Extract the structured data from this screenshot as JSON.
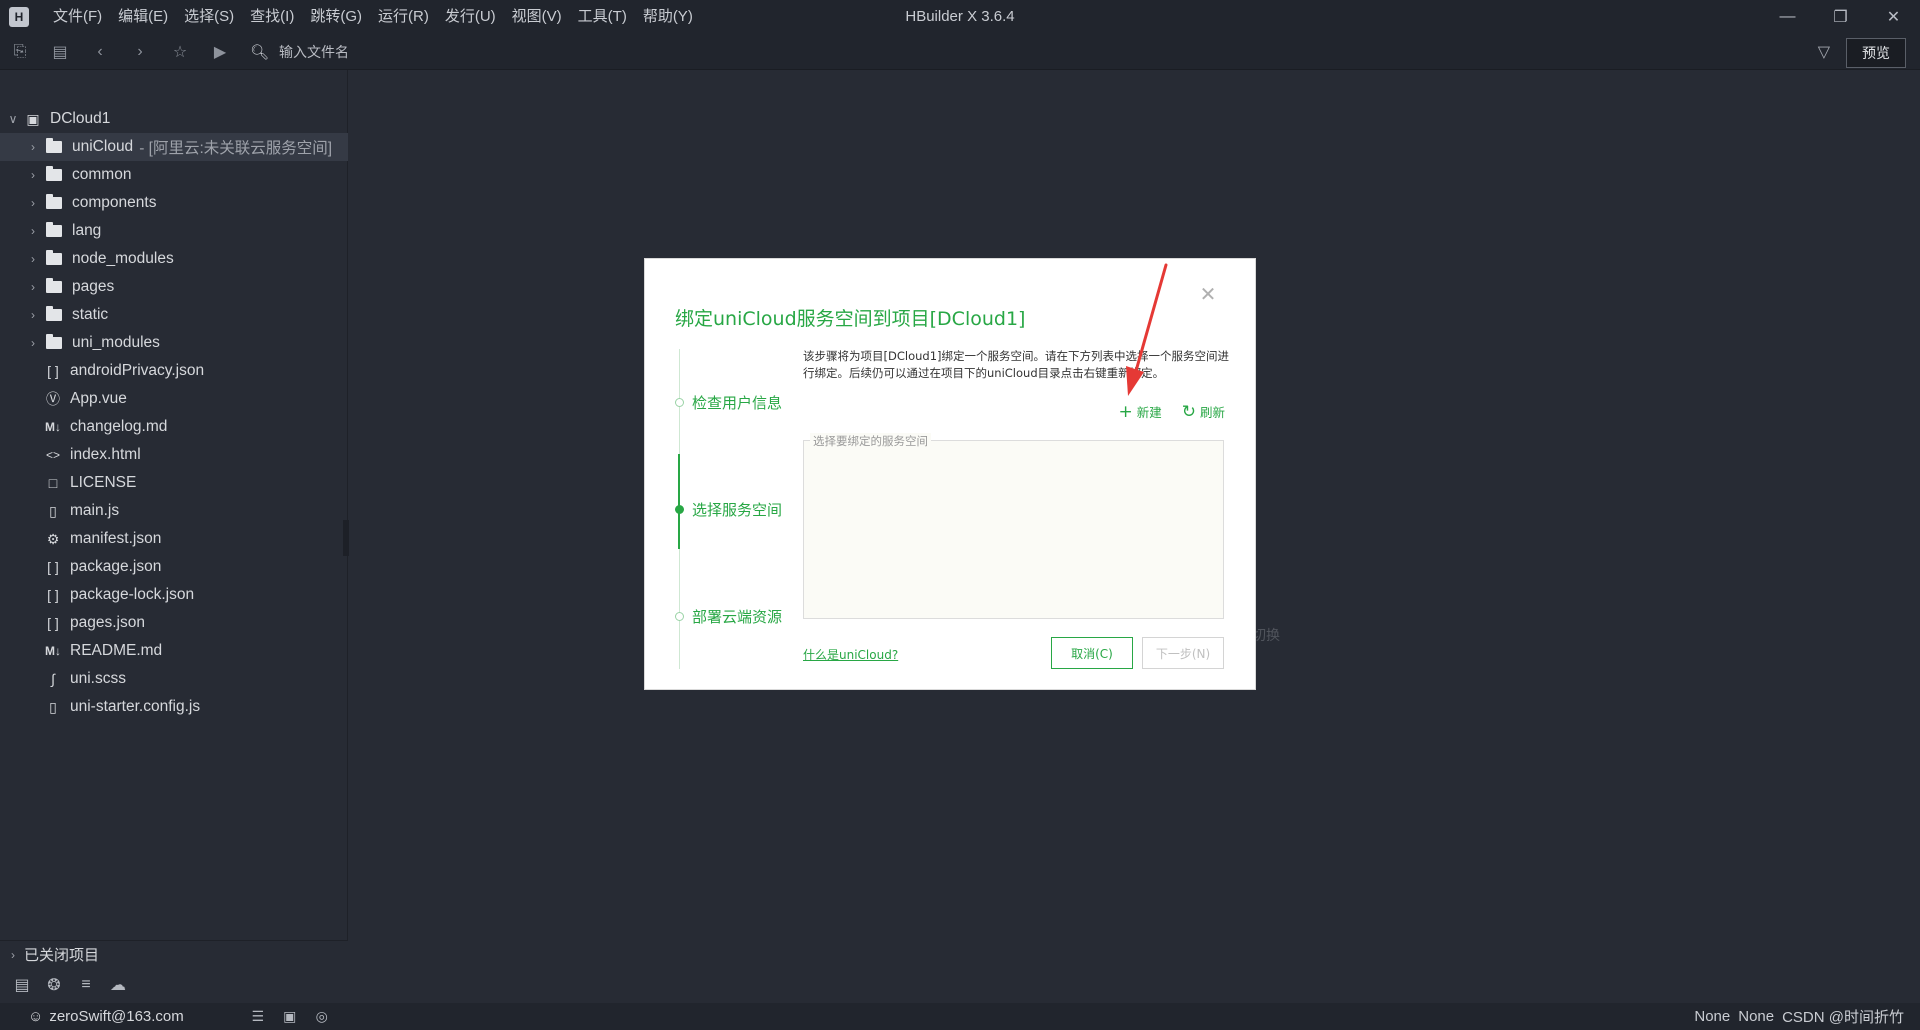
{
  "app": {
    "window_title": "HBuilder X 3.6.4",
    "logo": "H"
  },
  "menu": [
    "文件(F)",
    "编辑(E)",
    "选择(S)",
    "查找(I)",
    "跳转(G)",
    "运行(R)",
    "发行(U)",
    "视图(V)",
    "工具(T)",
    "帮助(Y)"
  ],
  "toolbar": {
    "file_search_placeholder": "输入文件名",
    "preview_label": "预览"
  },
  "sidebar": {
    "project": "DCloud1",
    "items": [
      {
        "label": "uniCloud",
        "note": " - [阿里云:未关联云服务空间]",
        "type": "folder",
        "expandable": true,
        "selected": true
      },
      {
        "label": "common",
        "type": "folder",
        "expandable": true
      },
      {
        "label": "components",
        "type": "folder",
        "expandable": true
      },
      {
        "label": "lang",
        "type": "folder",
        "expandable": true
      },
      {
        "label": "node_modules",
        "type": "folder",
        "expandable": true
      },
      {
        "label": "pages",
        "type": "folder",
        "expandable": true
      },
      {
        "label": "static",
        "type": "folder",
        "expandable": true
      },
      {
        "label": "uni_modules",
        "type": "folder",
        "expandable": true
      },
      {
        "label": "androidPrivacy.json",
        "type": "json"
      },
      {
        "label": "App.vue",
        "type": "vue"
      },
      {
        "label": "changelog.md",
        "type": "md"
      },
      {
        "label": "index.html",
        "type": "html"
      },
      {
        "label": "LICENSE",
        "type": "file"
      },
      {
        "label": "main.js",
        "type": "js"
      },
      {
        "label": "manifest.json",
        "type": "manifest"
      },
      {
        "label": "package.json",
        "type": "json"
      },
      {
        "label": "package-lock.json",
        "type": "json"
      },
      {
        "label": "pages.json",
        "type": "json"
      },
      {
        "label": "README.md",
        "type": "md"
      },
      {
        "label": "uni.scss",
        "type": "scss"
      },
      {
        "label": "uni-starter.config.js",
        "type": "js"
      }
    ],
    "closed_projects": "已关闭项目"
  },
  "statusbar": {
    "user": "zeroSwift@163.com",
    "right_1": "None",
    "right_2": "None",
    "watermark": "CSDN @时间折竹"
  },
  "editor": {
    "hint_fragment": "切换"
  },
  "dialog": {
    "title": "绑定uniCloud服务空间到项目[DCloud1]",
    "steps": [
      "检查用户信息",
      "选择服务空间",
      "部署云端资源"
    ],
    "description": "该步骤将为项目[DCloud1]绑定一个服务空间。请在下方列表中选择一个服务空间进行绑定。后续仍可以通过在项目下的uniCloud目录点击右键重新绑定。",
    "new_label": "新建",
    "refresh_label": "刷新",
    "space_legend": "选择要绑定的服务空间",
    "what_link": "什么是uniCloud?",
    "cancel_label": "取消(C)",
    "next_label": "下一步(N)"
  },
  "colors": {
    "accent": "#28a745",
    "annotation_arrow": "#e53935"
  }
}
